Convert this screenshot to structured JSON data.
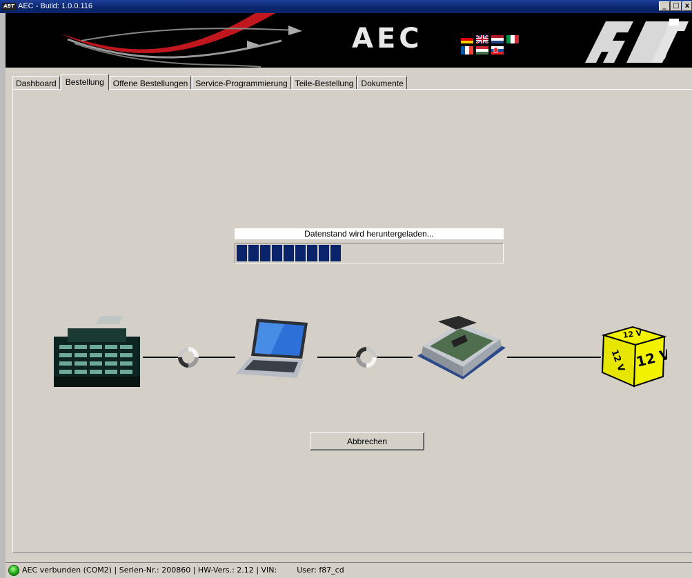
{
  "window": {
    "title": "AEC - Build: 1.0.0.116",
    "app_icon_text": "ABT"
  },
  "banner": {
    "product": "AEC",
    "brand": "ABT"
  },
  "tabs": [
    "Dashboard",
    "Bestellung",
    "Offene Bestellungen",
    "Service-Programmierung",
    "Teile-Bestellung",
    "Dokumente"
  ],
  "active_tab": "Bestellung",
  "download": {
    "status_text": "Datenstand wird heruntergeladen...",
    "progress_segments_filled": 9,
    "progress_fraction": 0.42,
    "bar_color": "#0a246a"
  },
  "flow": {
    "nodes": [
      "abt-headquarters",
      "laptop",
      "ecu-module",
      "12v-power-cube"
    ],
    "power_cube_label": "12 V",
    "cube_color": "#f2f200"
  },
  "cancel_button": "Abbrechen",
  "statusbar": {
    "connection": "AEC verbunden (COM2)",
    "serial": "Serien-Nr.: 200860",
    "hw_version": "HW-Vers.: 2.12",
    "vin": "VIN:",
    "user": "User:  f87_cd",
    "led_color": "#18a00c"
  }
}
